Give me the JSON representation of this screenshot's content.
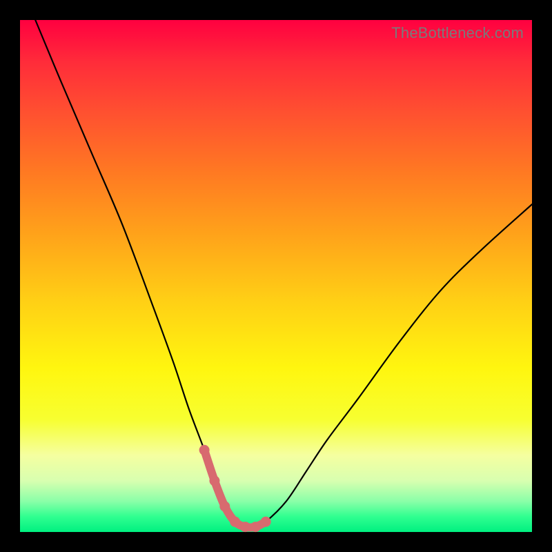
{
  "watermark": "TheBottleneck.com",
  "colors": {
    "accent": "#d86a6f",
    "curve": "#000000",
    "background_frame": "#000000"
  },
  "chart_data": {
    "type": "line",
    "title": "",
    "xlabel": "",
    "ylabel": "",
    "xlim": [
      0,
      100
    ],
    "ylim": [
      0,
      100
    ],
    "grid": false,
    "legend": false,
    "series": [
      {
        "name": "bottleneck-curve",
        "x": [
          3,
          8,
          14,
          20,
          26,
          30,
          33,
          36,
          38,
          40,
          42,
          44,
          46,
          48,
          52,
          56,
          60,
          66,
          74,
          82,
          90,
          100
        ],
        "y": [
          100,
          88,
          74,
          60,
          44,
          33,
          24,
          16,
          10,
          5,
          2,
          1,
          1,
          2,
          6,
          12,
          18,
          26,
          37,
          47,
          55,
          64
        ]
      }
    ],
    "accent_segment": {
      "name": "optimal-range",
      "x": [
        36,
        38,
        40,
        42,
        44,
        46,
        48
      ],
      "y": [
        16,
        10,
        5,
        2,
        1,
        1,
        2
      ]
    }
  }
}
